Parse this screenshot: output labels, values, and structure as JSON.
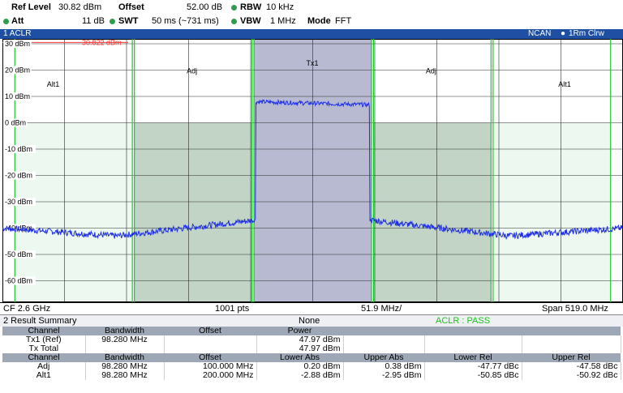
{
  "header": {
    "ref_level_label": "Ref Level",
    "ref_level_value": "30.82 dBm",
    "offset_label": "Offset",
    "offset_value": "52.00 dB",
    "rbw_label": "RBW",
    "rbw_value": "10 kHz",
    "att_label": "Att",
    "att_value": "11 dB",
    "swt_label": "SWT",
    "swt_value": "50 ms (~731 ms)",
    "vbw_label": "VBW",
    "vbw_value": "1 MHz",
    "mode_label": "Mode",
    "mode_value": "FFT",
    "indicator_color": "#2e9d4e"
  },
  "window": {
    "title": "1 ACLR",
    "right_label": "NCAN",
    "trace_label": "1Rm Clrw",
    "title_color": "#1e4fa3"
  },
  "plot": {
    "y_labels": [
      "30 dBm",
      "20 dBm",
      "10 dBm",
      "0 dBm",
      "-10 dBm",
      "-20 dBm",
      "-30 dBm",
      "-40 dBm",
      "-50 dBm",
      "-60 dBm"
    ],
    "ref_line_label": "30.822 dBm",
    "channel_labels": {
      "alt1_left": "Alt1",
      "adj_left": "Adj",
      "tx1": "Tx1",
      "adj_right": "Adj",
      "alt1_right": "Alt1"
    },
    "colors": {
      "tx": "#b7bad0",
      "adj": "#c2d4c6",
      "alt": "#edf8f1",
      "trace": "#1d2ee6",
      "limit": "#19c829",
      "ref": "#ff3b3b"
    }
  },
  "chart_data": {
    "type": "line",
    "title": "1 ACLR",
    "xlabel": "",
    "ylabel": "",
    "ylim": [
      -70,
      30
    ],
    "y_unit": "dBm",
    "center_frequency": "CF 2.6 GHz",
    "points": "1001 pts",
    "div": "51.9 MHz/",
    "span": "Span 519.0 MHz",
    "reference_level": 30.822,
    "channels": [
      {
        "name": "Alt1",
        "offset_mhz": -200,
        "bandwidth_mhz": 98.28
      },
      {
        "name": "Adj",
        "offset_mhz": -100,
        "bandwidth_mhz": 98.28
      },
      {
        "name": "Tx1",
        "offset_mhz": 0,
        "bandwidth_mhz": 98.28
      },
      {
        "name": "Adj",
        "offset_mhz": 100,
        "bandwidth_mhz": 98.28
      },
      {
        "name": "Alt1",
        "offset_mhz": 200,
        "bandwidth_mhz": 98.28
      }
    ],
    "trace_levels_dbm": {
      "tx_band": 8,
      "adj_near_tx": -37,
      "adj_far": -40,
      "alt": -43,
      "edge": -40
    }
  },
  "footer": {
    "cf": "CF 2.6 GHz",
    "pts": "1001 pts",
    "div": "51.9 MHz/",
    "span": "Span 519.0 MHz"
  },
  "result": {
    "title": "2 Result Summary",
    "none": "None",
    "status": "ACLR : PASS",
    "status_color": "#18c418",
    "header1": [
      "Channel",
      "Bandwidth",
      "Offset",
      "Power",
      "",
      "",
      ""
    ],
    "rows1": [
      [
        "Tx1 (Ref)",
        "98.280 MHz",
        "",
        "47.97 dBm",
        "",
        "",
        ""
      ],
      [
        "Tx Total",
        "",
        "",
        "47.97 dBm",
        "",
        "",
        ""
      ]
    ],
    "header2": [
      "Channel",
      "Bandwidth",
      "Offset",
      "Lower Abs",
      "Upper Abs",
      "Lower Rel",
      "Upper Rel"
    ],
    "rows2": [
      [
        "Adj",
        "98.280 MHz",
        "100.000 MHz",
        "0.20 dBm",
        "0.38 dBm",
        "-47.77 dBc",
        "-47.58 dBc"
      ],
      [
        "Alt1",
        "98.280 MHz",
        "200.000 MHz",
        "-2.88 dBm",
        "-2.95 dBm",
        "-50.85 dBc",
        "-50.92 dBc"
      ]
    ]
  }
}
